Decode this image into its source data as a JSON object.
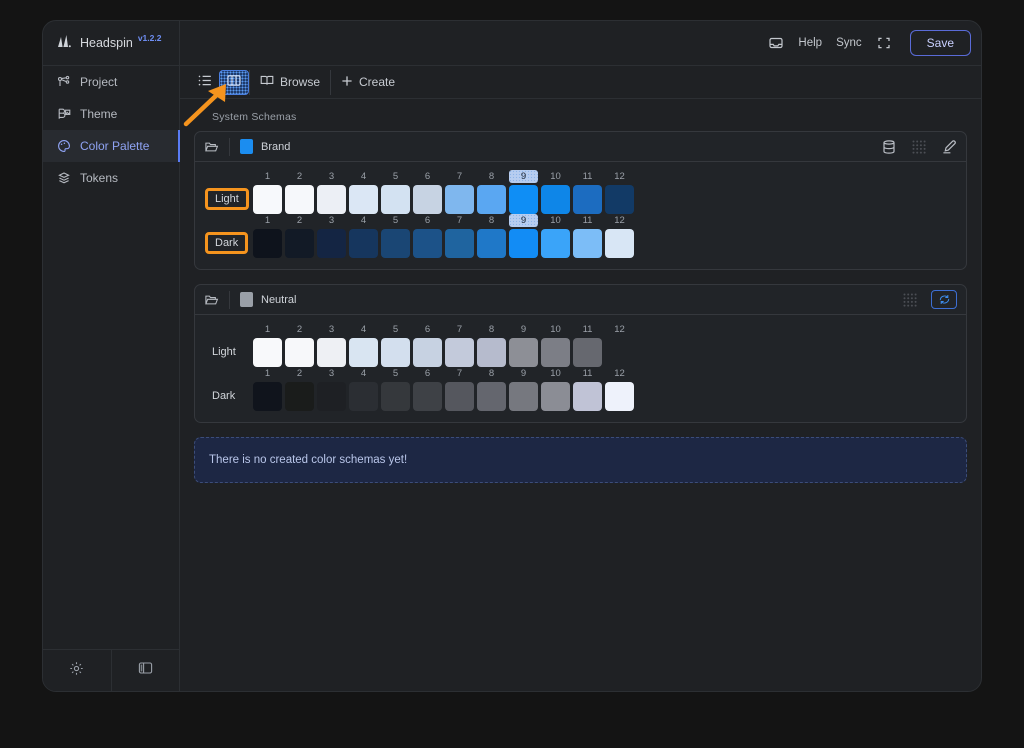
{
  "app": {
    "logo_icon": "headspin-logo-icon",
    "name": "Headspin",
    "version": "v1.2.2"
  },
  "topbar": {
    "inbox_icon": "inbox-icon",
    "help_label": "Help",
    "sync_label": "Sync",
    "fullscreen_icon": "fullscreen-icon",
    "save_label": "Save",
    "save_border_color": "#5a6bd8"
  },
  "sidebar": {
    "items": [
      {
        "label": "Project",
        "icon": "project-node-icon",
        "active": false
      },
      {
        "label": "Theme",
        "icon": "theme-layers-icon",
        "active": false
      },
      {
        "label": "Color Palette",
        "icon": "palette-icon",
        "active": true
      },
      {
        "label": "Tokens",
        "icon": "tokens-stack-icon",
        "active": false
      }
    ],
    "active_color": "#8fa3f3",
    "footer": [
      {
        "icon": "brightness-sun-icon",
        "name": "theme-toggle"
      },
      {
        "icon": "panel-layout-icon",
        "name": "panel-toggle"
      }
    ]
  },
  "toolbar": {
    "items": [
      {
        "label": "",
        "icon": "list-view-icon",
        "selected": false
      },
      {
        "label": "",
        "icon": "columns-view-icon",
        "selected": true
      },
      {
        "label": "Browse",
        "icon": "book-open-icon",
        "selected": false
      },
      {
        "label": "Create",
        "icon": "plus-icon",
        "selected": false
      }
    ],
    "selected_accent": "#4b7fe0"
  },
  "annotation": {
    "arrow_color": "#f5941e",
    "points_to": "columns-view-icon"
  },
  "main": {
    "section_title": "System Schemas",
    "notice": "There is no created color schemas yet!",
    "notice_bg": "#1d2744",
    "notice_border": "#3c4d7a",
    "highlight_color": "#f5941e"
  },
  "schemas": [
    {
      "name": "Brand",
      "swatch_color": "#1b8df0",
      "folder_icon": "folder-open-icon",
      "actions": [
        {
          "icon": "database-icon",
          "name": "database-button",
          "boxed": false,
          "dim": false
        },
        {
          "icon": "grid-dots-icon",
          "name": "grid-dots-button",
          "boxed": false,
          "dim": true
        },
        {
          "icon": "edit-pencil-icon",
          "name": "edit-button",
          "boxed": false,
          "dim": false
        }
      ],
      "columns": [
        "1",
        "2",
        "3",
        "4",
        "5",
        "6",
        "7",
        "8",
        "9",
        "10",
        "11",
        "12"
      ],
      "selected_column": "9",
      "rows": [
        {
          "label": "Light",
          "highlighted": true,
          "colors": [
            "#f7f9fc",
            "#f6f8fb",
            "#eceff5",
            "#dbe7f5",
            "#d3e2f2",
            "#c7d3e3",
            "#7fb7ee",
            "#5aa7f2",
            "#0f8ef5",
            "#0e86e8",
            "#1c6cc0",
            "#123a66"
          ]
        },
        {
          "label": "Dark",
          "highlighted": true,
          "colors": [
            "#0e131c",
            "#121a26",
            "#142543",
            "#16365e",
            "#1a4674",
            "#1c5288",
            "#1f649f",
            "#1f78c8",
            "#128cf5",
            "#3aa4f9",
            "#7cbdf7",
            "#d8e6f5"
          ]
        }
      ]
    },
    {
      "name": "Neutral",
      "swatch_color": "#9aa0a8",
      "folder_icon": "folder-open-icon",
      "actions": [
        {
          "icon": "grid-dots-icon",
          "name": "grid-dots-button",
          "boxed": false,
          "dim": true
        },
        {
          "icon": "refresh-icon",
          "name": "refresh-button",
          "boxed": true,
          "dim": false
        }
      ],
      "columns": [
        "1",
        "2",
        "3",
        "4",
        "5",
        "6",
        "7",
        "8",
        "9",
        "10",
        "11",
        "12"
      ],
      "selected_column": null,
      "rows": [
        {
          "label": "Light",
          "highlighted": false,
          "colors": [
            "#f8f9fb",
            "#f7f8fa",
            "#eef0f4",
            "#d9e5f2",
            "#d3dfee",
            "#c7d2e2",
            "#c3cadb",
            "#b6bbcd",
            "#8d8f96",
            "#7c7e86",
            "#66686f",
            "#1f2124"
          ]
        },
        {
          "label": "Dark",
          "highlighted": false,
          "colors": [
            "#10141c",
            "#1a1c1b",
            "#1e2024",
            "#2b2e33",
            "#35383c",
            "#3e4146",
            "#55575e",
            "#64666e",
            "#76787f",
            "#8b8d95",
            "#c0c3d6",
            "#eef2fb"
          ]
        }
      ]
    }
  ]
}
